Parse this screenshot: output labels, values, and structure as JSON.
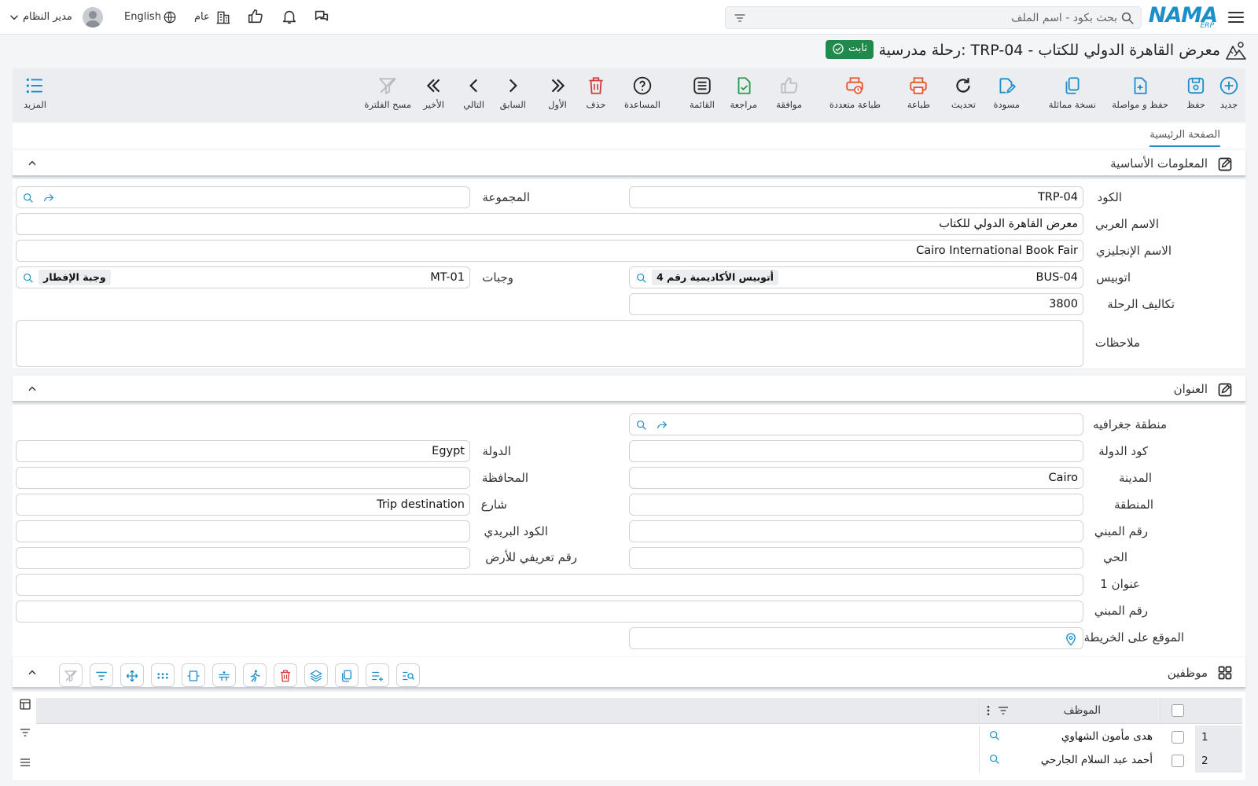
{
  "header": {
    "logo_text": "NAMA",
    "logo_sub": "ERP",
    "search_placeholder": "بحث بكود - اسم الملف",
    "branch_label": "عام",
    "language_label": "English",
    "user_name": "مدير النظام",
    "icons": [
      "menu-icon",
      "search-icon",
      "filter-icon",
      "building-icon",
      "thumbs-up-icon",
      "bell-icon",
      "chat-icon",
      "globe-icon",
      "user-icon",
      "chevron-down-icon"
    ]
  },
  "page": {
    "title": "رحلة مدرسية: TRP-04 - معرض القاهرة الدولي للكتاب",
    "status_badge": "ثابت",
    "status_color": "#1f8a4c"
  },
  "toolbar": {
    "new": "جديد",
    "save": "حفظ",
    "save_continue": "حفظ و مواصلة",
    "duplicate": "نسخة مماثلة",
    "draft": "مسودة",
    "refresh": "تحديث",
    "print": "طباعة",
    "multi_print": "طباعة متعددة",
    "approve": "موافقة",
    "review": "مراجعة",
    "list": "القائمة",
    "help": "المساعدة",
    "delete": "حذف",
    "first": "الأول",
    "previous": "السابق",
    "next": "التالي",
    "last": "الأخير",
    "clear_filter": "مسح الفلترة",
    "more": "المزيد"
  },
  "tabs": [
    "الصفحة الرئيسية"
  ],
  "basic_info": {
    "section_title": "المعلومات الأساسية",
    "code_label": "الكود",
    "code_value": "TRP-04",
    "group_label": "المجموعة",
    "group_value": "",
    "arabic_name_label": "الاسم العربي",
    "arabic_name_value": "معرض القاهرة الدولي للكتاب",
    "english_name_label": "الاسم الإنجليزي",
    "english_name_value": "Cairo International Book Fair",
    "bus_label": "اتوبيس",
    "bus_code": "BUS-04",
    "bus_name": "أتوبيس الأكاديمية رقم 4",
    "meals_label": "وجبات",
    "meals_code": "MT-01",
    "meals_name": "وجبة الإفطار",
    "cost_label": "تكاليف الرحلة",
    "cost_value": "3800",
    "notes_label": "ملاحظات",
    "notes_value": ""
  },
  "address": {
    "section_title": "العنوان",
    "geo_region_label": "منطقة جغرافيه",
    "country_code_label": "كود الدولة",
    "country_code_value": "",
    "country_label": "الدولة",
    "country_value": "Egypt",
    "city_label": "المدينة",
    "city_value": "Cairo",
    "governorate_label": "المحافظة",
    "governorate_value": "",
    "area_label": "المنطقة",
    "area_value": "",
    "street_label": "شارع",
    "street_value": "Trip destination",
    "building_no_label": "رقم المبني",
    "building_no_value": "",
    "postal_code_label": "الكود البريدي",
    "postal_code_value": "",
    "district_label": "الحي",
    "district_value": "",
    "land_id_label": "رقم تعريفي للأرض",
    "land_id_value": "",
    "address1_label": "عنوان 1",
    "address1_value": "",
    "building_no2_label": "رقم المبني",
    "building_no2_value": "",
    "map_location_label": "الموقع على الخريطة"
  },
  "employees": {
    "section_title": "موظفين",
    "column_employee": "الموظف",
    "rows": [
      {
        "num": "1",
        "name": "هدى مأمون الشهاوي"
      },
      {
        "num": "2",
        "name": "أحمد عبد السلام الجارحي"
      }
    ]
  }
}
